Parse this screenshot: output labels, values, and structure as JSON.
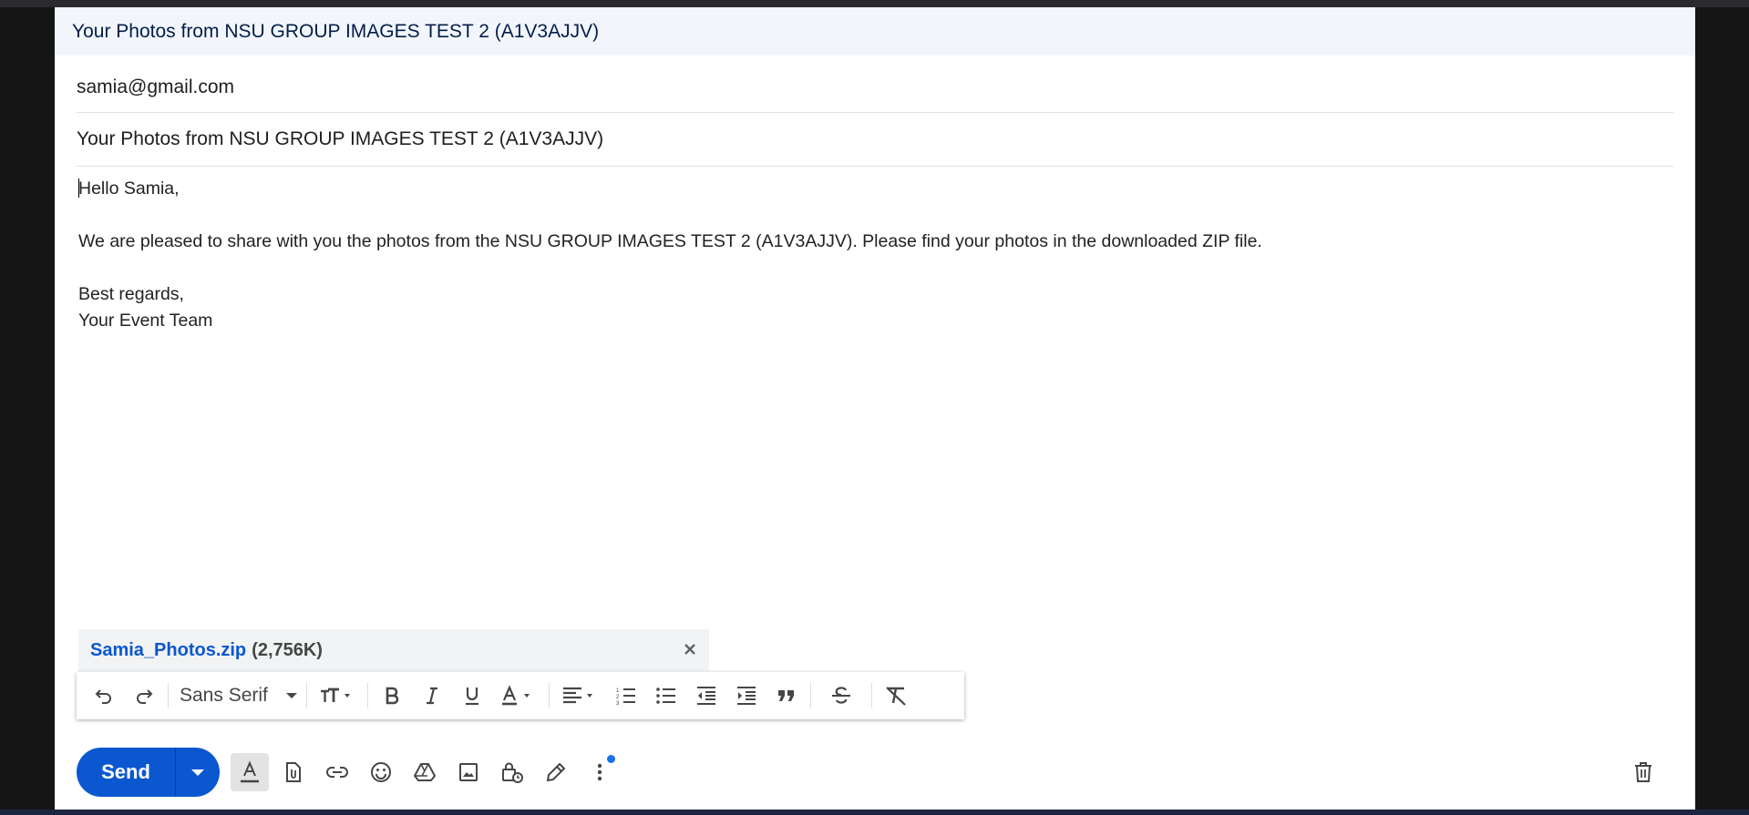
{
  "compose": {
    "header_title": "Your Photos from NSU GROUP IMAGES TEST 2 (A1V3AJJV)",
    "to": "samia@gmail.com",
    "subject": "Your Photos from NSU GROUP IMAGES TEST 2 (A1V3AJJV)",
    "body": {
      "greeting": "Hello Samia,",
      "paragraph": "We are pleased to share with you the photos from the NSU GROUP IMAGES TEST 2 (A1V3AJJV). Please find your photos in the downloaded ZIP file.",
      "closing": "Best regards,",
      "signature": "Your Event Team"
    }
  },
  "attachment": {
    "name": "Samia_Photos.zip",
    "size": "(2,756K)",
    "close_icon": "close-icon"
  },
  "formatting_toolbar": {
    "font": "Sans Serif",
    "icons": [
      "undo-icon",
      "redo-icon",
      "text-size-icon",
      "bold-icon",
      "italic-icon",
      "underline-icon",
      "text-color-icon",
      "align-icon",
      "numbered-list-icon",
      "bulleted-list-icon",
      "indent-less-icon",
      "indent-more-icon",
      "quote-icon",
      "strikethrough-icon",
      "remove-formatting-icon"
    ]
  },
  "bottom_toolbar": {
    "send_label": "Send",
    "icons": [
      "formatting-options-icon",
      "attach-file-icon",
      "insert-link-icon",
      "emoji-icon",
      "drive-icon",
      "insert-photo-icon",
      "confidential-mode-icon",
      "signature-icon",
      "more-options-icon",
      "discard-draft-icon"
    ],
    "colors": {
      "send_button": "#0b57d0",
      "notification_dot": "#1a73e8"
    }
  }
}
